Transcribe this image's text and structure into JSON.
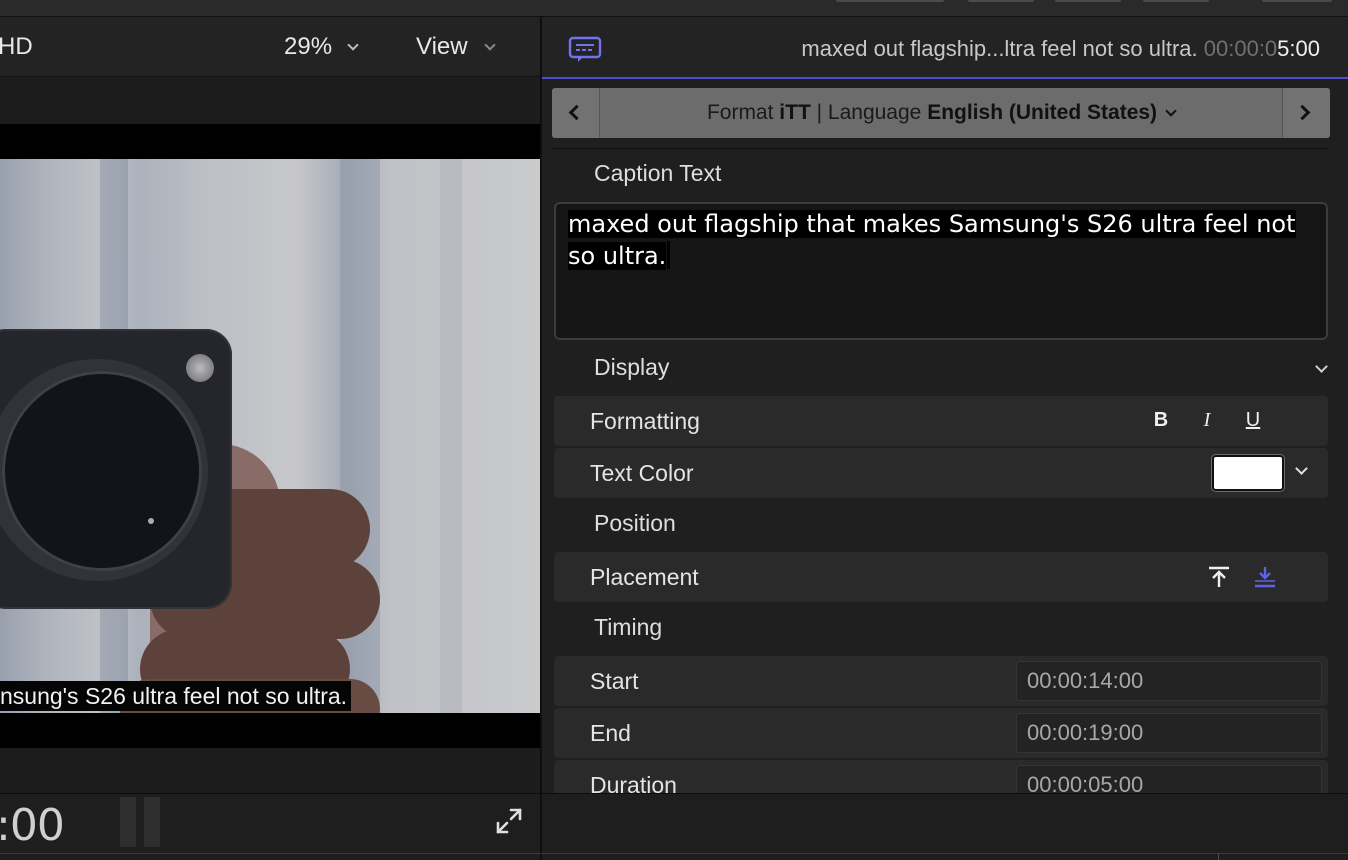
{
  "viewer": {
    "format_label": "HD",
    "zoom_label": "29%",
    "view_label": "View",
    "overlay_caption": "nsung's S26 ultra feel not so ultra.",
    "timecode": ":00"
  },
  "inspector": {
    "header_title_left": "maxed out flagship...ltra feel not so ultra.",
    "header_time_dim": "00:00:0",
    "header_time_bright": "5:00",
    "format_prefix": "Format ",
    "format_value": "iTT",
    "language_prefix": " | Language ",
    "language_value": "English (United States)",
    "caption_text_label": "Caption Text",
    "caption_text": "maxed out flagship that makes Samsung's S26 ultra feel not so ultra.",
    "display_label": "Display",
    "formatting_label": "Formatting",
    "bold": "B",
    "italic": "I",
    "underline": "U",
    "text_color_label": "Text Color",
    "text_color_value": "#ffffff",
    "position_label": "Position",
    "placement_label": "Placement",
    "timing_label": "Timing",
    "start_label": "Start",
    "start_value": "00:00:14:00",
    "end_label": "End",
    "end_value": "00:00:19:00",
    "duration_label": "Duration",
    "duration_value": "00:00:05:00"
  },
  "colors": {
    "accent": "#4b4fd1",
    "cursor": "#e0408a",
    "placement_active": "#5a64e6"
  }
}
